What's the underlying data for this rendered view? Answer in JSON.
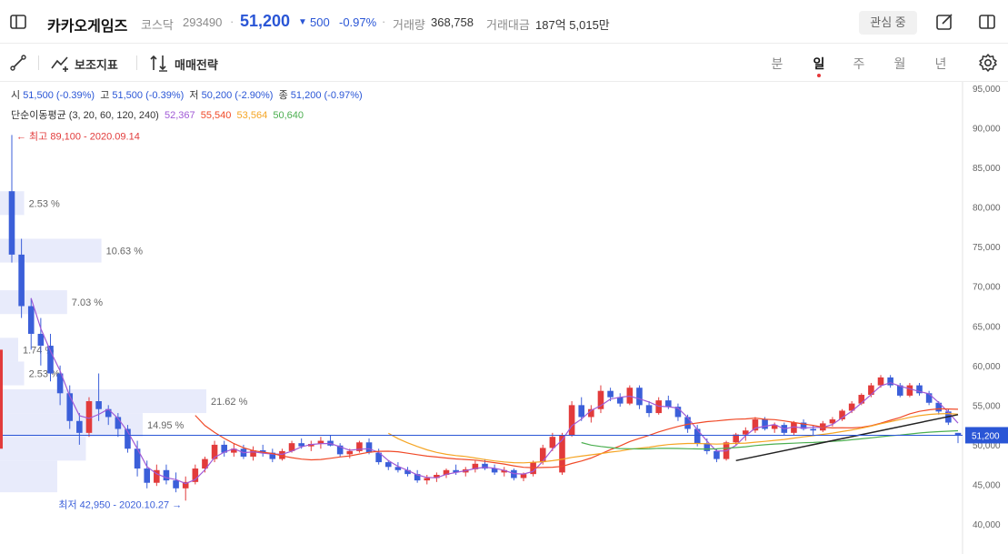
{
  "header": {
    "stock_name": "카카오게임즈",
    "market": "코스닥",
    "code": "293490",
    "separator": "·",
    "price": "51,200",
    "change_arrow": "▼",
    "change": "500",
    "change_pct": "-0.97%",
    "volume_label": "거래량",
    "volume": "368,758",
    "amount_label": "거래대금",
    "amount": "187억 5,015만",
    "watch_label": "관심 중"
  },
  "toolbar": {
    "indicator_label": "보조지표",
    "strategy_label": "매매전략",
    "periods": [
      "분",
      "일",
      "주",
      "월",
      "년"
    ],
    "active_period": "일"
  },
  "ohlc": {
    "open_label": "시",
    "open": "51,500 (-0.39%)",
    "high_label": "고",
    "high": "51,500 (-0.39%)",
    "low_label": "저",
    "low": "50,200 (-2.90%)",
    "close_label": "종",
    "close": "51,200 (-0.97%)"
  },
  "ma": {
    "label": "단순이동평균 (3, 20, 60, 120, 240)",
    "values": [
      {
        "value": "52,367",
        "color": "#a05ad6"
      },
      {
        "value": "55,540",
        "color": "#f04a28"
      },
      {
        "value": "53,564",
        "color": "#f5a524"
      },
      {
        "value": "50,640",
        "color": "#4caf50"
      }
    ]
  },
  "colors": {
    "up": "#e23b3b",
    "down": "#3b5fd9",
    "current_line": "#2a56d6",
    "volume_profile": "#e8ebfb"
  },
  "chart_data": {
    "type": "candlestick",
    "y_axis": {
      "min": 40000,
      "max": 95000,
      "ticks": [
        95000,
        90000,
        85000,
        80000,
        75000,
        70000,
        65000,
        60000,
        55000,
        50000,
        45000,
        40000
      ],
      "tick_labels": [
        "95,000",
        "90,000",
        "85,000",
        "80,000",
        "75,000",
        "70,000",
        "65,000",
        "60,000",
        "55,000",
        "50,000",
        "45,000",
        "40,000"
      ],
      "position": "right"
    },
    "current_price": {
      "value": 51200,
      "label": "51,200"
    },
    "high_annotation": {
      "value": 89100,
      "label": "최고 89,100 - 2020.09.14",
      "arrow": "←"
    },
    "low_annotation": {
      "value": 42950,
      "label": "최저 42,950 - 2020.10.27",
      "arrow": "→"
    },
    "volume_profile": [
      {
        "price_low": 79000,
        "price_high": 82000,
        "pct": 2.53,
        "label": "2.53 %"
      },
      {
        "price_low": 73000,
        "price_high": 76000,
        "pct": 10.63,
        "label": "10.63 %"
      },
      {
        "price_low": 66500,
        "price_high": 69500,
        "pct": 7.03,
        "label": "7.03 %"
      },
      {
        "price_low": 60500,
        "price_high": 63500,
        "pct": 1.74,
        "label": "1.74 %"
      },
      {
        "price_low": 57500,
        "price_high": 60500,
        "pct": 2.53,
        "label": "2.53 %"
      },
      {
        "price_low": 54000,
        "price_high": 57000,
        "pct": 21.62,
        "label": "21.62 %"
      },
      {
        "price_low": 51000,
        "price_high": 54000,
        "pct": 14.95,
        "label": "14.95 %"
      },
      {
        "price_low": 48000,
        "price_high": 51000,
        "pct": 9.0,
        "label": ""
      },
      {
        "price_low": 44000,
        "price_high": 48000,
        "pct": 6.0,
        "label": ""
      }
    ],
    "candles": [
      [
        82000,
        89100,
        73000,
        74000
      ],
      [
        74000,
        76000,
        66000,
        67500
      ],
      [
        67500,
        68500,
        62000,
        64000
      ],
      [
        64000,
        66000,
        60000,
        62500
      ],
      [
        62500,
        64000,
        58000,
        59000
      ],
      [
        59000,
        60000,
        55000,
        56500
      ],
      [
        56500,
        57500,
        52000,
        53000
      ],
      [
        53000,
        54000,
        50000,
        51500
      ],
      [
        51500,
        56000,
        51000,
        55500
      ],
      [
        55500,
        59000,
        53000,
        54500
      ],
      [
        54500,
        55000,
        52500,
        53500
      ],
      [
        53500,
        54000,
        51000,
        52000
      ],
      [
        52000,
        52500,
        49000,
        49500
      ],
      [
        49500,
        50500,
        46000,
        47000
      ],
      [
        47000,
        48000,
        44500,
        45200
      ],
      [
        45200,
        47500,
        44800,
        46800
      ],
      [
        46800,
        47500,
        45000,
        45500
      ],
      [
        45500,
        46500,
        44000,
        44500
      ],
      [
        44500,
        46000,
        42950,
        45300
      ],
      [
        45300,
        47500,
        45000,
        47000
      ],
      [
        47000,
        48500,
        46500,
        48200
      ],
      [
        48200,
        50500,
        47800,
        50000
      ],
      [
        50000,
        50500,
        48500,
        49000
      ],
      [
        49000,
        50200,
        48500,
        49500
      ],
      [
        49500,
        50000,
        48200,
        48500
      ],
      [
        48500,
        49800,
        48000,
        49300
      ],
      [
        49300,
        50000,
        48500,
        49000
      ],
      [
        49000,
        49500,
        47800,
        48200
      ],
      [
        48200,
        49500,
        48000,
        49200
      ],
      [
        49200,
        50500,
        49000,
        50200
      ],
      [
        50200,
        50800,
        49500,
        49800
      ],
      [
        49800,
        50500,
        49200,
        50100
      ],
      [
        50100,
        51000,
        49500,
        50500
      ],
      [
        50500,
        51200,
        49800,
        49900
      ],
      [
        49900,
        50200,
        48500,
        48800
      ],
      [
        48800,
        49500,
        48300,
        49200
      ],
      [
        49200,
        50500,
        49000,
        50300
      ],
      [
        50300,
        50800,
        48800,
        49000
      ],
      [
        49000,
        49500,
        47500,
        47800
      ],
      [
        47800,
        48000,
        46800,
        47200
      ],
      [
        47200,
        47800,
        46500,
        46800
      ],
      [
        46800,
        47200,
        46000,
        46300
      ],
      [
        46300,
        46800,
        45200,
        45500
      ],
      [
        45500,
        46200,
        45000,
        45800
      ],
      [
        45800,
        46500,
        45300,
        46200
      ],
      [
        46200,
        47000,
        45800,
        46800
      ],
      [
        46800,
        47500,
        46200,
        46500
      ],
      [
        46500,
        47200,
        46000,
        46900
      ],
      [
        46900,
        48000,
        46500,
        47600
      ],
      [
        47600,
        48200,
        46800,
        47000
      ],
      [
        47000,
        47500,
        46200,
        46500
      ],
      [
        46500,
        47200,
        46000,
        46800
      ],
      [
        46800,
        47000,
        45500,
        45800
      ],
      [
        45800,
        46500,
        45400,
        46300
      ],
      [
        46300,
        48000,
        46000,
        47800
      ],
      [
        47800,
        50000,
        47500,
        49600
      ],
      [
        49600,
        51500,
        49200,
        51000
      ],
      [
        46500,
        51500,
        46200,
        51200
      ],
      [
        51200,
        55500,
        51000,
        55000
      ],
      [
        55000,
        56000,
        53000,
        53500
      ],
      [
        53500,
        55000,
        52800,
        54500
      ],
      [
        54500,
        57500,
        54000,
        56800
      ],
      [
        56800,
        57200,
        55500,
        56000
      ],
      [
        56000,
        56500,
        54800,
        55200
      ],
      [
        55200,
        57500,
        55000,
        57200
      ],
      [
        57200,
        57500,
        54500,
        55000
      ],
      [
        55000,
        55500,
        53500,
        54000
      ],
      [
        54000,
        56000,
        53800,
        55600
      ],
      [
        55600,
        56200,
        54500,
        54800
      ],
      [
        54800,
        55200,
        53000,
        53500
      ],
      [
        53500,
        53800,
        51500,
        52000
      ],
      [
        52000,
        52500,
        49800,
        50200
      ],
      [
        50200,
        50800,
        48800,
        49200
      ],
      [
        49200,
        49500,
        47800,
        48200
      ],
      [
        48200,
        50500,
        48000,
        50300
      ],
      [
        50300,
        51500,
        50000,
        51300
      ],
      [
        51300,
        52200,
        50500,
        51800
      ],
      [
        51800,
        53500,
        51500,
        53200
      ],
      [
        53200,
        53500,
        51800,
        52000
      ],
      [
        52000,
        52800,
        51500,
        52500
      ],
      [
        52500,
        52800,
        51200,
        51500
      ],
      [
        51500,
        53000,
        51200,
        52800
      ],
      [
        52800,
        53200,
        51800,
        52000
      ],
      [
        52000,
        52500,
        51200,
        51800
      ],
      [
        51800,
        53000,
        51600,
        52700
      ],
      [
        52700,
        53500,
        52300,
        53200
      ],
      [
        53200,
        54500,
        53000,
        54300
      ],
      [
        54300,
        55500,
        54000,
        55200
      ],
      [
        55200,
        56500,
        55000,
        56300
      ],
      [
        56300,
        57800,
        56000,
        57500
      ],
      [
        57500,
        58800,
        57200,
        58500
      ],
      [
        58500,
        58800,
        57200,
        57500
      ],
      [
        57500,
        57800,
        56000,
        56200
      ],
      [
        56200,
        57800,
        56000,
        57500
      ],
      [
        57500,
        57800,
        56200,
        56500
      ],
      [
        56500,
        56800,
        55000,
        55300
      ],
      [
        55300,
        55500,
        53800,
        54200
      ],
      [
        54200,
        54500,
        52500,
        52800
      ],
      [
        51500,
        51500,
        50200,
        51200
      ]
    ],
    "ma_lines": [
      {
        "period": 3,
        "color": "#a05ad6",
        "values": [
          null,
          null,
          null,
          null,
          null,
          null,
          null,
          null,
          null,
          null,
          null,
          null,
          null,
          null,
          null,
          null,
          null,
          null,
          null,
          null,
          null,
          null,
          null,
          null,
          null,
          null,
          null,
          null,
          null,
          null,
          null,
          null,
          null,
          null,
          null,
          null,
          null,
          null,
          null,
          null,
          null,
          null,
          null,
          null,
          null,
          null,
          null,
          null,
          null,
          null,
          null,
          null,
          null,
          null,
          null,
          null,
          null,
          null,
          null,
          null,
          null,
          null,
          null,
          null,
          null,
          null,
          null,
          null,
          null,
          null,
          null,
          null,
          null,
          null,
          null,
          null,
          null,
          null,
          null,
          null,
          null,
          null,
          null,
          null,
          null,
          null,
          null,
          null,
          null,
          null,
          null,
          null,
          null,
          null,
          null,
          null,
          null,
          null,
          null,
          null
        ]
      }
    ]
  }
}
